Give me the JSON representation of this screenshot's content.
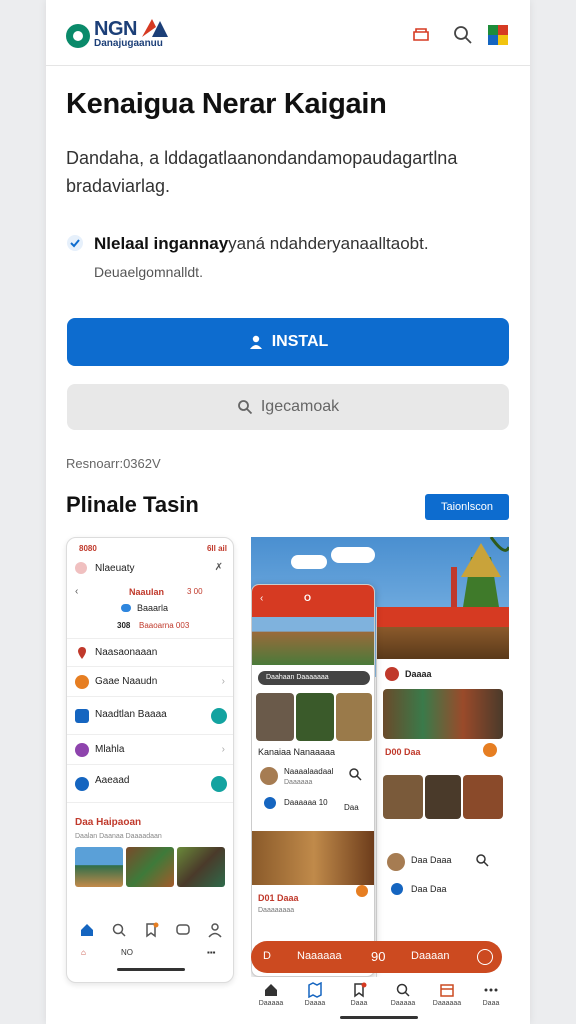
{
  "header": {
    "logo_top": "NGN",
    "logo_bottom": "Danajugaanuu",
    "icons": [
      "cart-icon",
      "search-icon",
      "grid-color-icon"
    ]
  },
  "hero": {
    "title": "Kenaigua Nerar Kaigain",
    "description": "Dandaha, a lddagatlaanondandamopaudagartlna bradaviarlag."
  },
  "feature": {
    "title_bold": "Nlelaal ingannay",
    "title_rest": "yaná ndahderyanaalltaobt.",
    "subtitle": "Deuaelgomnalldt."
  },
  "actions": {
    "install_label": "INSTAL",
    "search_label": "Igecamoak"
  },
  "meta_text": "Resnoarr:0362V",
  "section": {
    "title": "Plinale Tasin",
    "button_label": "Taionlscon"
  },
  "phone1": {
    "status_left": "8080",
    "status_right": "6ll ail",
    "app_title": "Nlaeuaty",
    "close_glyph": "✗",
    "sub_left": "Naaulan",
    "sub_right": "3 00",
    "location": "Baaarla",
    "rating_left": "308",
    "rating_right": "Baaoarna 003",
    "list": [
      {
        "label": "Naasaonaaan",
        "color": "#c0392b"
      },
      {
        "label": "Gaae Naaudn",
        "color": "#e67e22"
      },
      {
        "label": "Naadtlan Baaaa",
        "color": "#1565c0"
      },
      {
        "label": "Mlahla",
        "color": "#8e44ad"
      },
      {
        "label": "Aaeaad",
        "color": "#1565c0"
      }
    ],
    "section_label": "Daa Haipaoan",
    "section_caption": "Daalan Daanaa Daaaadaan",
    "bottom_text": "NO"
  },
  "phone2": {
    "header_label": "O",
    "search_placeholder": "Daahaan Daaaaaaa",
    "caption1": "Kanaiaa Nanaaaaa",
    "user1": "Naaaalaadaal",
    "user1_sub": "Daaaaaa",
    "item1": "Daaaaaa 10",
    "item1_price": "Daa",
    "caption2": "D01 Daaa",
    "caption2_sub": "Daaaaaaaa"
  },
  "phone3": {
    "title": "Daaaa",
    "caption": "D00 Daa",
    "user": "Daa Daaa",
    "item": "Daa Daa"
  },
  "bottom_bar": {
    "left": "D",
    "middle": "Naaaaaa",
    "count": "90",
    "right": "Daaaan"
  },
  "nav": [
    "Daaaaa",
    "Daaaa",
    "Daaa",
    "Daaaaa",
    "Daaaaaa",
    "Daaa"
  ],
  "colors": {
    "accent_blue": "#0d6ccf",
    "accent_red": "#d63a22",
    "accent_orange": "#cc4a20"
  }
}
